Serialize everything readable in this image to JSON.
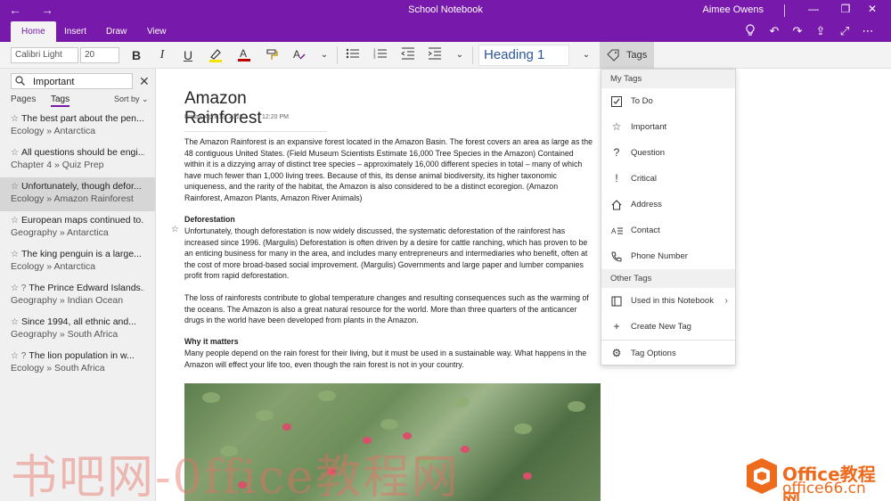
{
  "titlebar": {
    "title": "School Notebook",
    "user": "Aimee Owens",
    "back_icon": "back-arrow-icon",
    "forward_icon": "forward-arrow-icon"
  },
  "ribbon": {
    "tabs": [
      {
        "label": "Home"
      },
      {
        "label": "Insert"
      },
      {
        "label": "Draw"
      },
      {
        "label": "View"
      }
    ],
    "accent_color": "#7719aa"
  },
  "toolbar": {
    "font_name": "Calibri Light",
    "font_size": "20",
    "style": "Heading 1",
    "bold": "B",
    "italic": "I",
    "underline": "U",
    "tags_label": "Tags"
  },
  "leftpane": {
    "search_value": "Important",
    "tabs": [
      {
        "label": "Pages"
      },
      {
        "label": "Tags"
      }
    ],
    "sort_label": "Sort by",
    "results": [
      {
        "title": "The best part about the pen...",
        "location": "Ecology » Antarctica",
        "icon": "☆"
      },
      {
        "title": "All questions should be engi...",
        "location": "Chapter 4 » Quiz Prep",
        "icon": "☆"
      },
      {
        "title": "Unfortunately, though defor...",
        "location": "Ecology » Amazon Rainforest",
        "icon": "☆"
      },
      {
        "title": "European maps continued to...",
        "location": "Geography » Antarctica",
        "icon": "☆"
      },
      {
        "title": "The king penguin is a large...",
        "location": "Ecology » Antarctica",
        "icon": "☆"
      },
      {
        "title": "The Prince Edward Islands...",
        "location": "Geography » Indian Ocean",
        "icon": "☆ ?"
      },
      {
        "title": "Since 1994, all ethnic and...",
        "location": "Geography » South Africa",
        "icon": "☆"
      },
      {
        "title": "The lion population in w...",
        "location": "Ecology » South Africa",
        "icon": "☆ ?"
      }
    ]
  },
  "page": {
    "title": "Amazon Rainforest",
    "date": "Friday, April 13, 2018",
    "time": "12:20 PM",
    "para1": "The Amazon Rainforest is an expansive forest located in the Amazon Basin.  The forest covers an area as large as the 48 contiguous United States. (Field Museum Scientists Estimate 16,000 Tree Species in the Amazon)  Contained within it is a dizzying array of distinct tree species – approximately 16,000 different species in total – many of which have much fewer than 1,000 living trees. Because of this, its dense animal biodiversity, its higher taxonomic uniqueness, and the rarity of the habitat, the Amazon is also considered to be a distinct ecoregion. (Amazon Rainforest, Amazon Plants, Amazon River Animals)",
    "heading2": "Deforestation",
    "para2": "Unfortunately, though deforestation is now widely discussed, the systematic deforestation of the rainforest has increased since 1996. (Margulis) Deforestation is often driven by a desire for cattle ranching, which has proven to be an enticing business for many in the area, and includes many entrepreneurs and intermediaries who benefit, often at the cost of more broad-based social improvement. (Margulis) Governments and large paper and lumber companies profit from rapid deforestation.",
    "para3": "The loss of rainforests contribute to global temperature changes and resulting consequences such as the warming of the oceans. The Amazon is also a great natural resource for the world. More than three quarters of the anticancer drugs in the world have been developed from plants in the Amazon.",
    "heading3": "Why it matters",
    "para4": "Many people depend on the rain forest for their living, but it must be used in a sustainable way. What happens in the Amazon will effect your life too, even though the rain forest is not in your country."
  },
  "tags_menu": {
    "my_tags_label": "My Tags",
    "items": [
      {
        "label": "To Do",
        "icon": "checkbox-icon"
      },
      {
        "label": "Important",
        "icon": "star-icon"
      },
      {
        "label": "Question",
        "icon": "question-icon"
      },
      {
        "label": "Critical",
        "icon": "exclamation-icon"
      },
      {
        "label": "Address",
        "icon": "house-icon"
      },
      {
        "label": "Contact",
        "icon": "contact-icon"
      },
      {
        "label": "Phone Number",
        "icon": "phone-icon"
      }
    ],
    "other_tags_label": "Other Tags",
    "used_in_notebook": "Used in this Notebook",
    "create_new_tag": "Create New Tag",
    "tag_options": "Tag Options"
  },
  "watermark": {
    "left_text": "书吧网-0ffice教程网",
    "brand_line1": "Office教程网",
    "brand_line2": "office66.cn"
  }
}
